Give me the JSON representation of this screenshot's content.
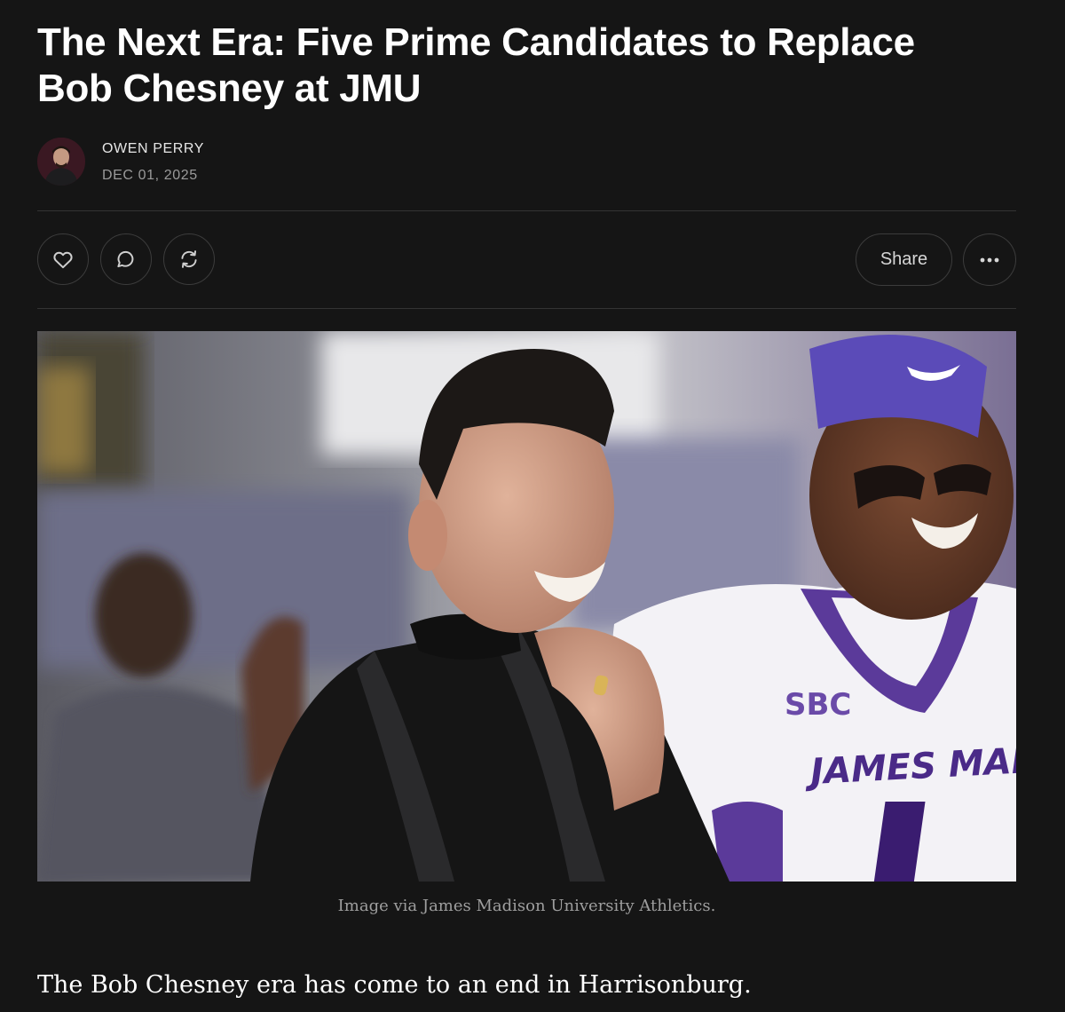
{
  "article": {
    "title": "The Next Era: Five Prime Candidates to Replace Bob Chesney at JMU",
    "author": "OWEN PERRY",
    "date": "DEC 01, 2025"
  },
  "actions": {
    "like_icon": "heart-icon",
    "comment_icon": "comment-bubble-icon",
    "restack_icon": "restack-icon",
    "share_label": "Share",
    "more_icon": "ellipsis-icon"
  },
  "hero_image": {
    "caption": "Image via James Madison University Athletics.",
    "jersey_patch": "SBC",
    "jersey_text": "JAMES MAD"
  },
  "body": {
    "first_paragraph": "The Bob Chesney era has come to an end in Harrisonburg."
  },
  "colors": {
    "background": "#151515",
    "text": "#ffffff",
    "muted": "#9a9a9a",
    "border": "#3c3c3c",
    "jmu_purple": "#450084"
  }
}
